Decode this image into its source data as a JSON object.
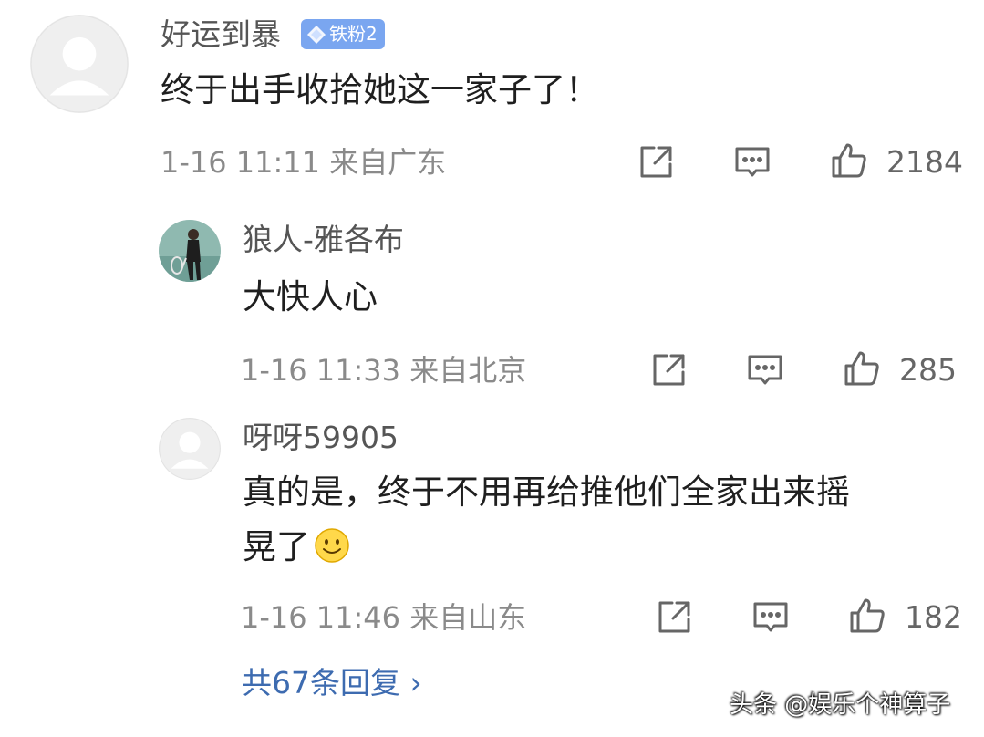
{
  "comments": [
    {
      "username": "好运到暴",
      "badge": "铁粉2",
      "content": "终于出手收拾她这一家子了！",
      "meta": "1-16 11:11 来自广东",
      "likes": "2184",
      "avatar": "default-avatar-icon"
    },
    {
      "username": "狼人-雅各布",
      "content": "大快人心",
      "meta": "1-16 11:33 来自北京",
      "likes": "285",
      "avatar": "tennis-player-avatar"
    },
    {
      "username": "呀呀59905",
      "content_line1": "真的是，终于不用再给推他们全家出来摇",
      "content_line2": "晃了",
      "meta": "1-16 11:46 来自山东",
      "likes": "182",
      "avatar": "default-avatar-icon",
      "emoji": "smile-emoji-icon"
    }
  ],
  "more_replies": "共67条回复 ›",
  "watermark": "头条 @娱乐个神算子",
  "colors": {
    "badge": "#7aa6f0",
    "link": "#3d6bb0",
    "meta": "#8a8a8a"
  }
}
